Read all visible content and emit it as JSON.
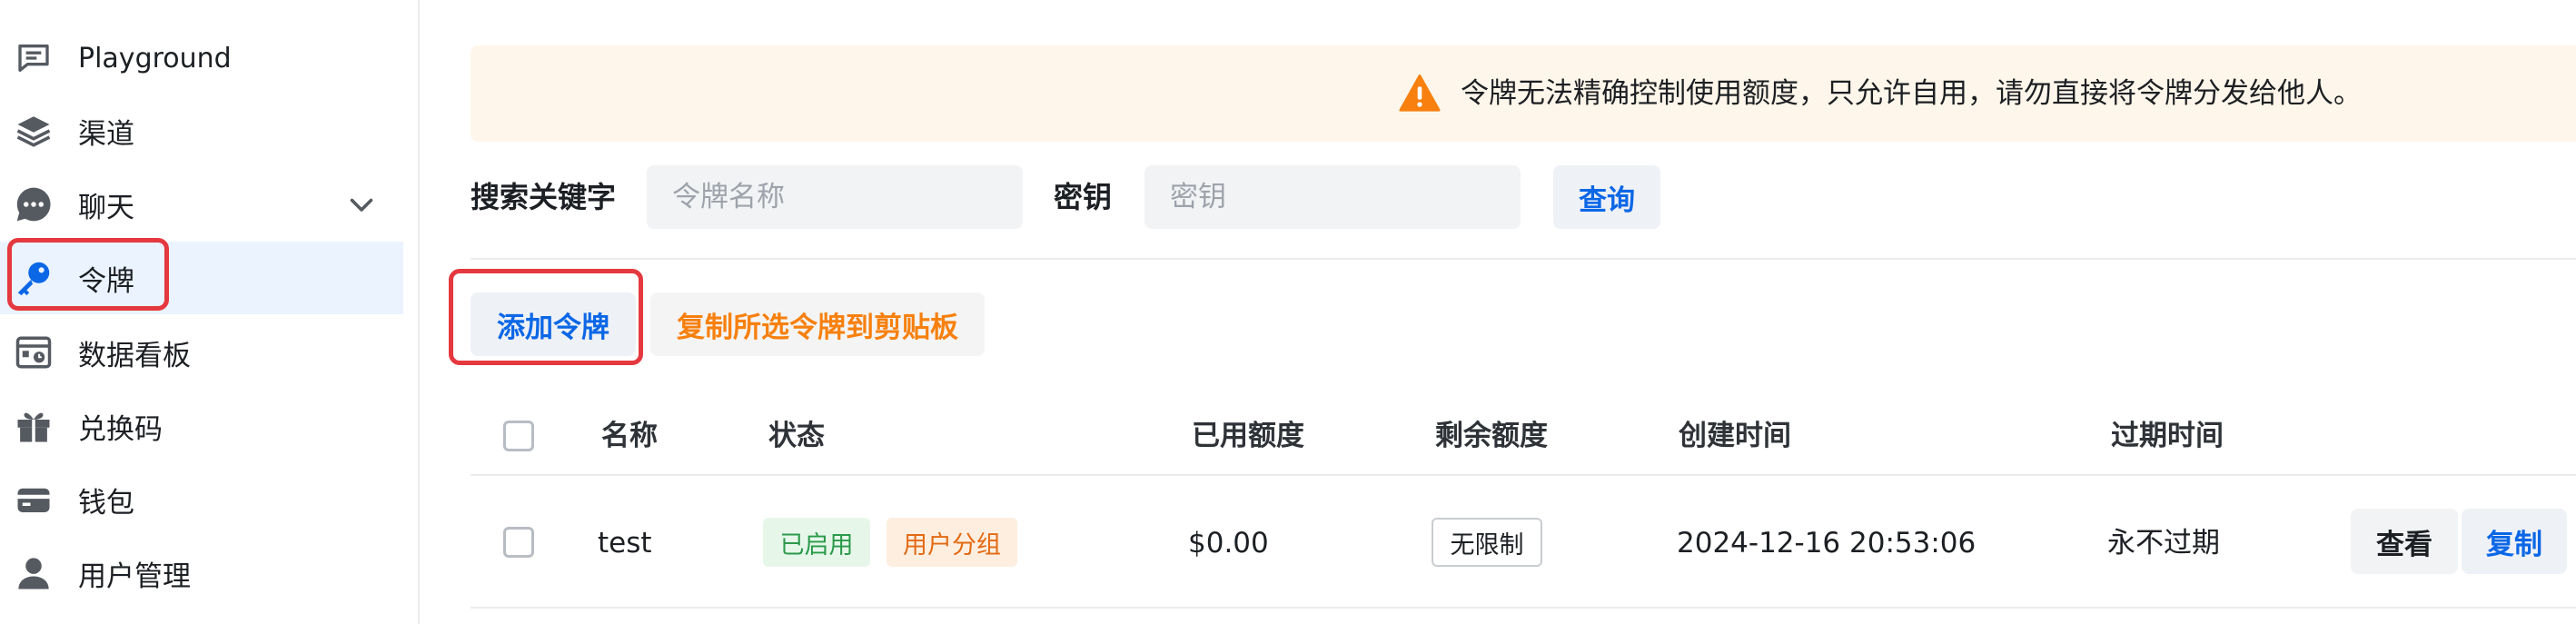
{
  "sidebar": {
    "items": [
      {
        "label": "Playground",
        "icon": "chat-square-icon"
      },
      {
        "label": "渠道",
        "icon": "layers-icon"
      },
      {
        "label": "聊天",
        "icon": "chat-bubble-icon"
      },
      {
        "label": "令牌",
        "icon": "key-icon",
        "active": true
      },
      {
        "label": "数据看板",
        "icon": "dashboard-icon"
      },
      {
        "label": "兑换码",
        "icon": "gift-icon"
      },
      {
        "label": "钱包",
        "icon": "wallet-icon"
      },
      {
        "label": "用户管理",
        "icon": "user-icon"
      }
    ]
  },
  "banner": {
    "text": "令牌无法精确控制使用额度，只允许自用，请勿直接将令牌分发给他人。"
  },
  "search": {
    "keyword_label": "搜索关键字",
    "keyword_placeholder": "令牌名称",
    "key_label": "密钥",
    "key_placeholder": "密钥",
    "query_button": "查询"
  },
  "actions": {
    "add_button": "添加令牌",
    "copy_selected_button": "复制所选令牌到剪贴板"
  },
  "table": {
    "headers": {
      "name": "名称",
      "status": "状态",
      "used": "已用额度",
      "remaining": "剩余额度",
      "created": "创建时间",
      "expires": "过期时间"
    },
    "rows": [
      {
        "name": "test",
        "status": "已启用",
        "group": "用户分组",
        "used": "$0.00",
        "remaining": "无限制",
        "created": "2024-12-16 20:53:06",
        "expires": "永不过期",
        "view_button": "查看",
        "copy_button": "复制"
      }
    ]
  },
  "colors": {
    "accent_blue": "#0b67e6",
    "accent_orange": "#f7800e",
    "highlight_red": "#e5383f",
    "banner_bg": "#fef6ea",
    "active_bg": "#eaf3ff"
  }
}
